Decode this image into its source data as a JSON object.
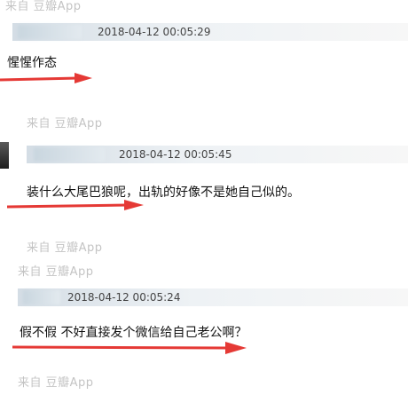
{
  "comments": [
    {
      "source": "来自 豆瓣App",
      "timestamp": "2018-04-12 00:05:29",
      "text": "惺惺作态"
    },
    {
      "source": "来自 豆瓣App",
      "timestamp": "2018-04-12 00:05:45",
      "text": "装什么大尾巴狼呢，出轨的好像不是她自己似的。"
    },
    {
      "source": "来自 豆瓣App",
      "timestamp": "2018-04-12 00:05:24",
      "text": "假不假 不好直接发个微信给自己老公啊？"
    }
  ],
  "footer_sources": [
    "来自 豆瓣App",
    "来自 豆瓣App",
    "来自 豆瓣App"
  ],
  "colors": {
    "arrow": "#e53935",
    "source_text": "#c4c4c4",
    "header_bar": "#dde4ea"
  }
}
